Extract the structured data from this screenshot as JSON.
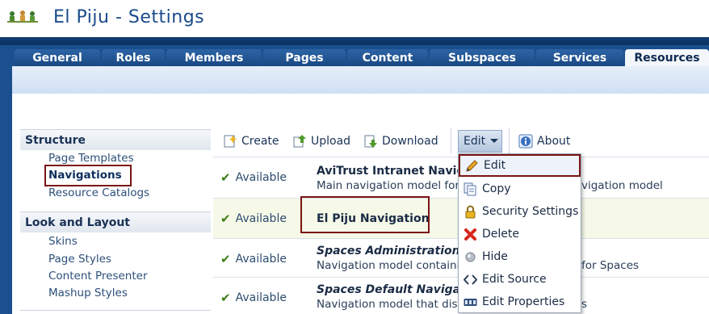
{
  "header": {
    "title": "El Piju  - Settings",
    "logo_icon": "group-logo-icon"
  },
  "tabs": [
    {
      "label": "General"
    },
    {
      "label": "Roles"
    },
    {
      "label": "Members"
    },
    {
      "label": "Pages"
    },
    {
      "label": "Content"
    },
    {
      "label": "Subspaces"
    },
    {
      "label": "Services"
    },
    {
      "label": "Resources",
      "active": true
    }
  ],
  "leftnav": {
    "groups": [
      {
        "title": "Structure",
        "items": [
          "Page Templates",
          "Navigations",
          "Resource Catalogs"
        ],
        "selected": "Navigations"
      },
      {
        "title": "Look and Layout",
        "items": [
          "Skins",
          "Page Styles",
          "Content Presenter",
          "Mashup Styles"
        ]
      }
    ]
  },
  "toolbar": {
    "create": "Create",
    "upload": "Upload",
    "download": "Download",
    "edit": "Edit",
    "about": "About"
  },
  "rows": [
    {
      "status": "Available",
      "name": "AviTrust Intranet Navig",
      "desc": "Main navigation model for th",
      "desc_tail": "vigation model"
    },
    {
      "status": "Available",
      "name": "El Piju Navigation",
      "desc": ""
    },
    {
      "status": "Available",
      "name": "Spaces Administration",
      "desc": "Navigation model containing",
      "desc_tail": "for Spaces"
    },
    {
      "status": "Available",
      "name": "Spaces Default Navigat",
      "desc": "Navigation model that displ",
      "desc_tail": "s"
    }
  ],
  "edit_menu": {
    "items": [
      {
        "label": "Edit",
        "icon": "pencil-icon"
      },
      {
        "label": "Copy",
        "icon": "copy-icon"
      },
      {
        "label": "Security Settings",
        "icon": "lock-icon"
      },
      {
        "label": "Delete",
        "icon": "delete-x-icon"
      },
      {
        "label": "Hide",
        "icon": "hide-circle-icon"
      },
      {
        "label": "Edit Source",
        "icon": "code-brackets-icon"
      },
      {
        "label": "Edit Properties",
        "icon": "properties-icon"
      }
    ]
  },
  "colors": {
    "tabbar": "#1b4f8e",
    "highlight": "#7b1414",
    "available_check": "#3d7d16",
    "row_alt": "#f6f9e8"
  }
}
